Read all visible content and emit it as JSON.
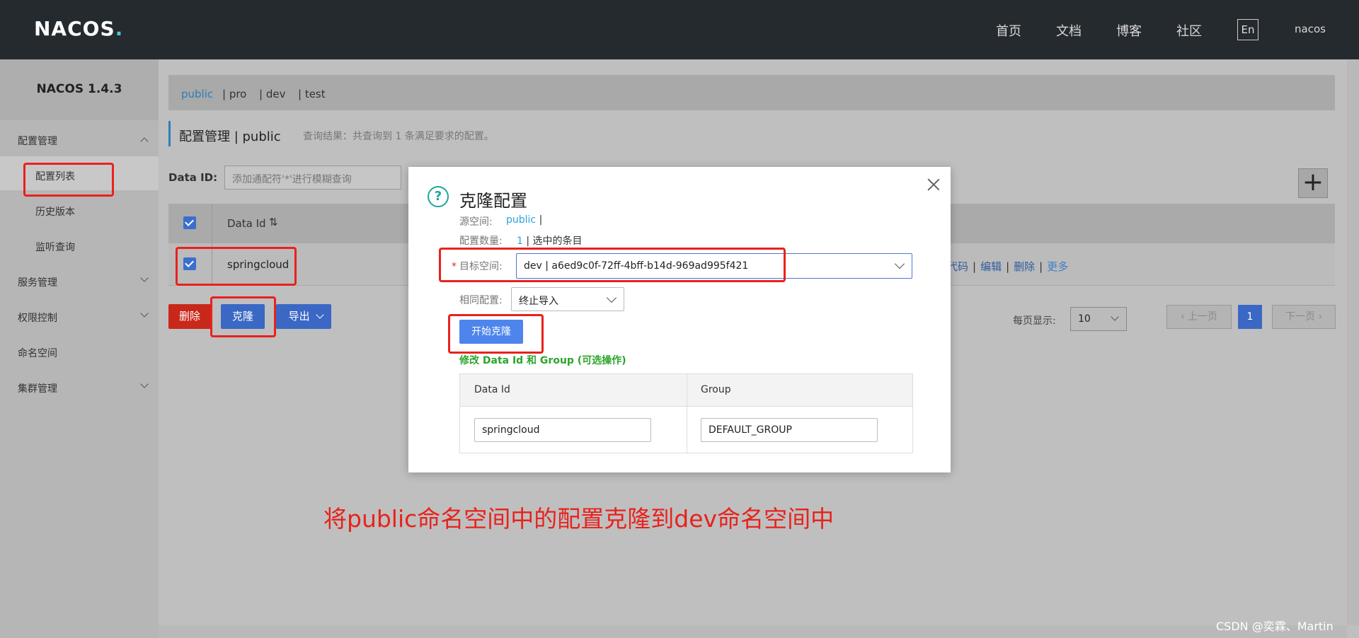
{
  "nav": {
    "logo_main": "NACOS",
    "logo_dot": ".",
    "links": [
      "首页",
      "文档",
      "博客",
      "社区"
    ],
    "lang": "En",
    "user": "nacos"
  },
  "sidebar": {
    "title": "NACOS 1.4.3",
    "items": [
      {
        "label": "配置管理"
      },
      {
        "label": "配置列表"
      },
      {
        "label": "历史版本"
      },
      {
        "label": "监听查询"
      },
      {
        "label": "服务管理"
      },
      {
        "label": "权限控制"
      },
      {
        "label": "命名空间"
      },
      {
        "label": "集群管理"
      }
    ]
  },
  "namespaces": [
    "public",
    "| pro",
    "| dev",
    "| test"
  ],
  "page": {
    "title": "配置管理 | public",
    "query_result": "查询结果：共查询到 1 条满足要求的配置。",
    "data_id_label": "Data ID:",
    "data_id_placeholder": "添加通配符'*'进行模糊查询",
    "add_label": "+"
  },
  "table": {
    "header_data_id": "Data Id",
    "sort_icon": "⇅",
    "row_data_id": "springcloud",
    "actions": [
      "代码",
      "编辑",
      "删除",
      "更多"
    ]
  },
  "buttons": {
    "delete": "删除",
    "clone": "克隆",
    "export": "导出"
  },
  "pager": {
    "label": "每页显示:",
    "size": "10",
    "prev": "上一页",
    "current": "1",
    "next": "下一页"
  },
  "modal": {
    "title": "克隆配置",
    "source_label": "源空间:",
    "source_value": "public",
    "source_sep": "|",
    "count_label": "配置数量:",
    "count_value": "1",
    "count_suffix": "| 选中的条目",
    "target_label": "目标空间:",
    "target_value": "dev | a6ed9c0f-72ff-4bff-b14d-969ad995f421",
    "same_label": "相同配置:",
    "same_value": "终止导入",
    "start_button": "开始克隆",
    "modify_hint": "修改 Data Id 和 Group (可选操作)",
    "col_data_id": "Data Id",
    "col_group": "Group",
    "input_data_id": "springcloud",
    "input_group": "DEFAULT_GROUP"
  },
  "annotation": "将public命名空间中的配置克隆到dev命名空间中",
  "watermark": "CSDN @奕霖、Martin",
  "colors": {
    "accent": "#3a68c4",
    "danger": "#c8281a",
    "annotation_red": "#e8221c",
    "hint_green": "#2aa52a"
  }
}
